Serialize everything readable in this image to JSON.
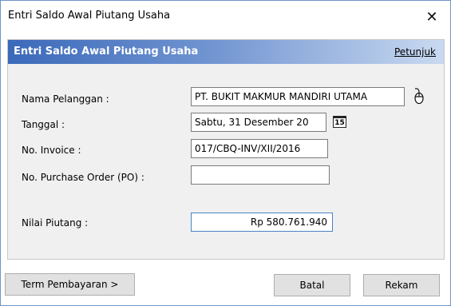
{
  "window": {
    "title": "Entri Saldo Awal Piutang Usaha",
    "close_glyph": "✕"
  },
  "banner": {
    "title": "Entri Saldo Awal Piutang Usaha",
    "help_label": "Petunjuk"
  },
  "form": {
    "customer_label": "Nama Pelanggan :",
    "customer_value": "PT. BUKIT MAKMUR MANDIRI UTAMA",
    "date_label": "Tanggal :",
    "date_value": "Sabtu, 31 Desember 20",
    "calendar_text": "15",
    "invoice_label": "No. Invoice :",
    "invoice_value": "017/CBQ-INV/XII/2016",
    "po_label": "No. Purchase Order (PO) :",
    "po_value": "",
    "amount_label": "Nilai Piutang :",
    "amount_value": "Rp 580.761.940"
  },
  "footer": {
    "terms_button": "Term Pembayaran >",
    "cancel_button": "Batal",
    "save_button": "Rekam"
  },
  "colors": {
    "banner_start": "#3b69ba",
    "banner_end": "#c9d9f0",
    "amount_border": "#4a82c8"
  },
  "icons": {
    "customer_lookup": "mouse-icon",
    "date_picker": "calendar-icon",
    "close": "close-icon"
  }
}
